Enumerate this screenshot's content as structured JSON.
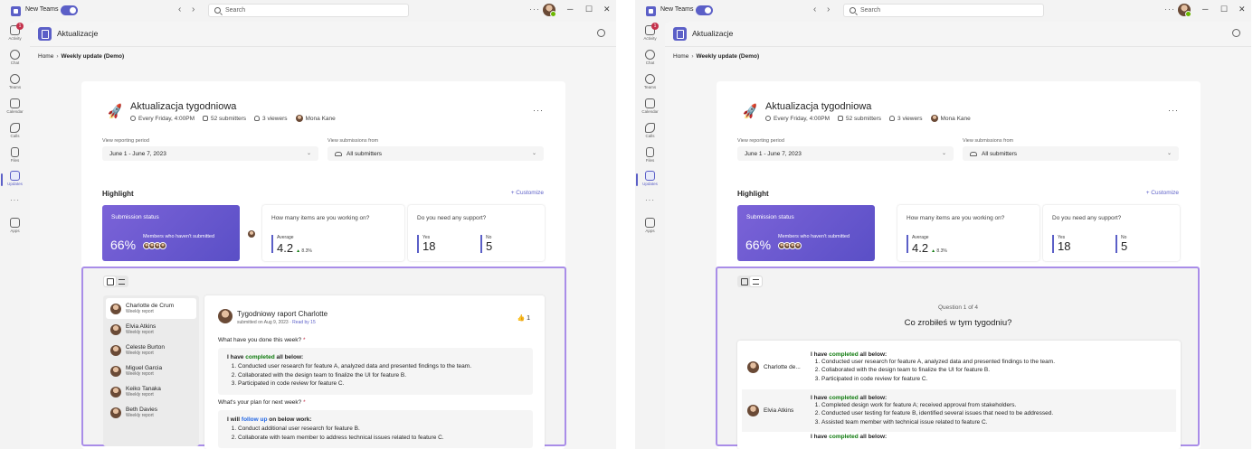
{
  "titlebar": {
    "app_label": "New Teams",
    "search_placeholder": "Search",
    "more": "···",
    "min": "─",
    "max": "☐",
    "close": "✕",
    "back": "‹",
    "forward": "›"
  },
  "rail": {
    "items": [
      {
        "label": "Activity",
        "icon": "bell-icon",
        "badge": "1"
      },
      {
        "label": "Chat",
        "icon": "chat-icon"
      },
      {
        "label": "Teams",
        "icon": "teams-icon"
      },
      {
        "label": "Calendar",
        "icon": "calendar-icon"
      },
      {
        "label": "Calls",
        "icon": "phone-icon"
      },
      {
        "label": "Files",
        "icon": "file-icon"
      },
      {
        "label": "Updates",
        "icon": "updates-icon",
        "active": true
      },
      {
        "label": "Apps",
        "icon": "apps-icon"
      }
    ],
    "more": "···"
  },
  "app": {
    "title": "Aktualizacje"
  },
  "breadcrumb": {
    "home": "Home",
    "current": "Weekly update (Demo)"
  },
  "page": {
    "title": "Aktualizacja tygodniowa",
    "schedule": "Every Friday, 4:00PM",
    "submitters": "52 submitters",
    "viewers": "3 viewers",
    "owner": "Mona Kane",
    "more": "···",
    "period_label": "View reporting period",
    "period_value": "June 1 - June 7, 2023",
    "from_label": "View submissions from",
    "from_value": "All submitters",
    "highlight": "Highlight",
    "customize": "+ Customize"
  },
  "tiles": {
    "status": {
      "title": "Submission status",
      "percent": "66%",
      "sub": "Members who haven't submitted"
    },
    "items": {
      "title": "How many items are you working on?",
      "label": "Average",
      "value": "4.2",
      "delta_arrow": "▲",
      "delta": "8.3%"
    },
    "support": {
      "title": "Do you need any support?",
      "yes_label": "Yes",
      "yes_value": "18",
      "no_label": "No",
      "no_value": "5"
    }
  },
  "left_detail": {
    "people": [
      {
        "name": "Charlotte de Crum",
        "sub": "Weekly report"
      },
      {
        "name": "Elvia Atkins",
        "sub": "Weekly report"
      },
      {
        "name": "Celeste Burton",
        "sub": "Weekly report"
      },
      {
        "name": "Miguel Garcia",
        "sub": "Weekly report"
      },
      {
        "name": "Keiko Tanaka",
        "sub": "Weekly report"
      },
      {
        "name": "Beth Davies",
        "sub": "Weekly report"
      }
    ],
    "report": {
      "title": "Tygodniowy raport Charlotte",
      "submitted": "submitted on Aug 9, 2023",
      "read": "Read by 15",
      "likes": "👍 1",
      "q1": "What have you done this week?",
      "q1_req": "*",
      "a1_pre": "I have ",
      "a1_hl": "completed",
      "a1_post": " all below:",
      "a1_items": [
        "Conducted user research for feature A, analyzed data and presented findings to the team.",
        "Collaborated with the design team to finalize the UI for feature B.",
        "Participated in code review for feature C."
      ],
      "q2": "What's your plan for next week?",
      "q2_req": "*",
      "a2_pre": "I will ",
      "a2_hl": "follow up",
      "a2_post": " on below work:",
      "a2_items": [
        "Conduct additional user research for feature B.",
        "Collaborate with team member to address technical issues related to feature C."
      ]
    }
  },
  "right_detail": {
    "question_num": "Question 1 of 4",
    "question": "Co zrobiłeś w tym tygodniu?",
    "rows": [
      {
        "name": "Charlotte de...",
        "pre": "I have ",
        "hl": "completed",
        "post": " all below:",
        "items": [
          "Conducted user research for feature A, analyzed data and presented findings to the team.",
          "Collaborated with the design team to finalize the UI for feature B.",
          "Participated in code review for feature C."
        ]
      },
      {
        "name": "Elvia Atkins",
        "pre": "I have ",
        "hl": "completed",
        "post": " all below:",
        "items": [
          "Completed design work for feature A; received approval from stakeholders.",
          "Conducted user testing for feature B, identified several issues that need to be addressed.",
          "Assisted team member with technical issue related to feature C."
        ]
      },
      {
        "name": "",
        "pre": "I have ",
        "hl": "completed",
        "post": " all below:",
        "items": []
      }
    ]
  },
  "colors": {
    "accent": "#5b5fc7",
    "highlight_border": "#a98de8",
    "green": "#0e7a0d",
    "link_blue": "#2266e3"
  }
}
